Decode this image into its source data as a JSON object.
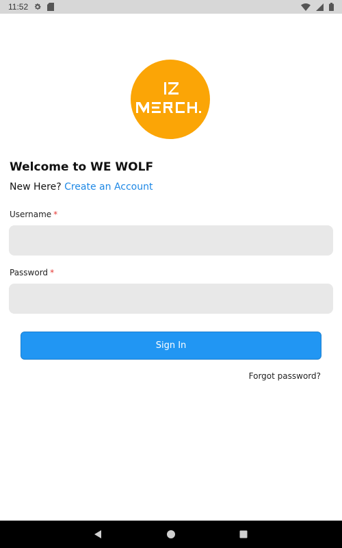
{
  "status_bar": {
    "time": "11:52",
    "icons": [
      "settings-gear-icon",
      "sd-card-icon",
      "wifi-icon",
      "cellular-signal-icon",
      "battery-icon"
    ]
  },
  "logo": {
    "line1": "IZ",
    "line2": "MERCH.",
    "background_color": "#fba506",
    "text_color": "#ffffff"
  },
  "header": {
    "welcome": "Welcome to WE WOLF",
    "new_here": "New Here?",
    "create_account": "Create an Account"
  },
  "form": {
    "username_label": "Username",
    "password_label": "Password",
    "required_marker": "*",
    "username_value": "",
    "password_value": "",
    "signin_label": "Sign In",
    "forgot_password": "Forgot password?"
  },
  "colors": {
    "accent": "#2196f3",
    "link": "#1e88e5",
    "required": "#e53935",
    "input_background": "#e8e8e8"
  },
  "nav_bar": {
    "buttons": [
      "back-icon",
      "home-icon",
      "recents-icon"
    ]
  }
}
